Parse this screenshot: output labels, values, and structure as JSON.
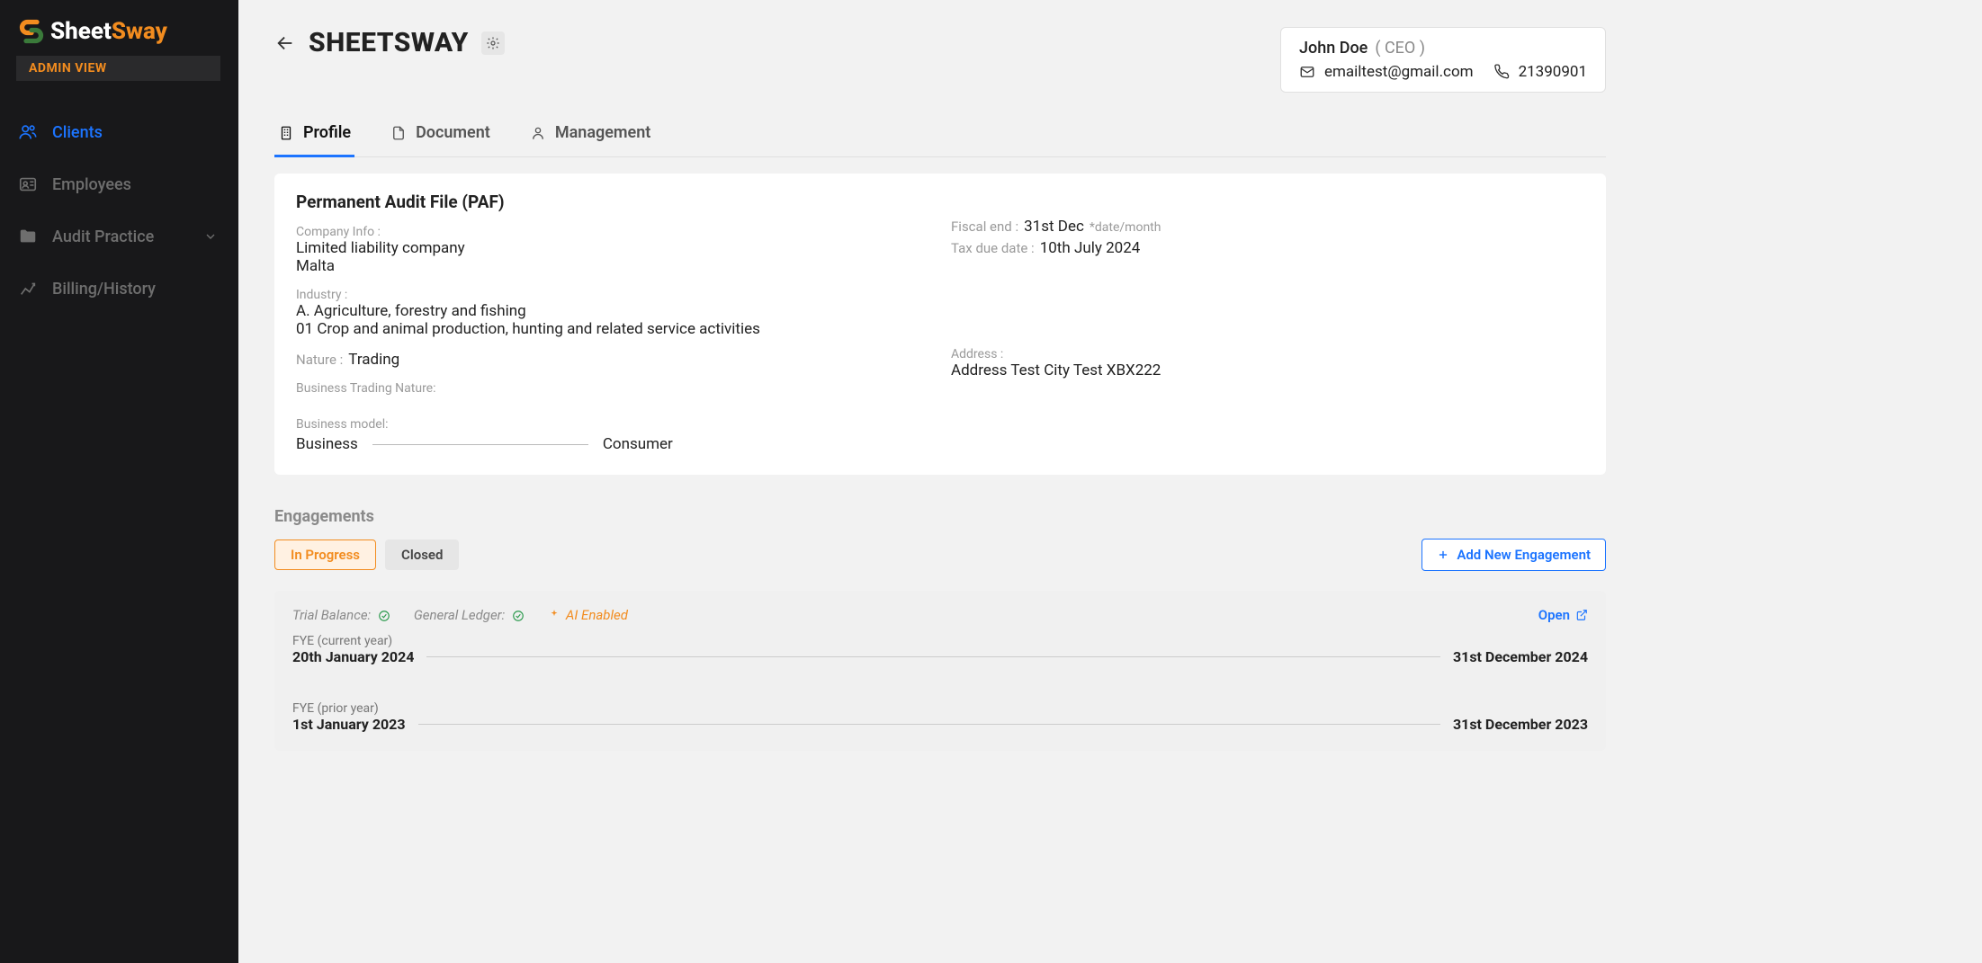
{
  "brand": {
    "part1": "Sheet",
    "part2": "Sway",
    "badge": "ADMIN VIEW"
  },
  "sidebar": {
    "items": [
      {
        "label": "Clients",
        "active": true
      },
      {
        "label": "Employees"
      },
      {
        "label": "Audit Practice",
        "expandable": true
      },
      {
        "label": "Billing/History"
      }
    ]
  },
  "header": {
    "title": "SHEETSWAY"
  },
  "user": {
    "name": "John Doe",
    "role": "( CEO )",
    "email": "emailtest@gmail.com",
    "phone": "21390901"
  },
  "tabs": [
    {
      "label": "Profile",
      "active": true
    },
    {
      "label": "Document"
    },
    {
      "label": "Management"
    }
  ],
  "paf": {
    "heading": "Permanent Audit File (PAF)",
    "company_info_label": "Company Info :",
    "company_type": "Limited liability company",
    "country": "Malta",
    "industry_label": "Industry :",
    "industry_section": "A. Agriculture, forestry and fishing",
    "industry_detail": "01 Crop and animal production, hunting and related service activities",
    "nature_label": "Nature :",
    "nature": "Trading",
    "btn_label": "Business Trading Nature:",
    "bmodel_label": "Business model:",
    "bmodel_left": "Business",
    "bmodel_right": "Consumer",
    "fiscal_end_label": "Fiscal end :",
    "fiscal_end": "31st Dec",
    "fiscal_hint": "*date/month",
    "tax_due_label": "Tax due date :",
    "tax_due": "10th July 2024",
    "address_label": "Address :",
    "address": "Address Test City Test XBX222"
  },
  "engagements": {
    "section_title": "Engagements",
    "filters": {
      "in_progress": "In Progress",
      "closed": "Closed"
    },
    "add_btn": "Add New Engagement",
    "meta": {
      "trial_balance_label": "Trial Balance:",
      "general_ledger_label": "General Ledger:",
      "ai_enabled": "AI Enabled",
      "open": "Open"
    },
    "current": {
      "caption": "FYE (current year)",
      "start": "20th January 2024",
      "end": "31st December 2024"
    },
    "prior": {
      "caption": "FYE (prior year)",
      "start": "1st January 2023",
      "end": "31st December 2023"
    }
  }
}
